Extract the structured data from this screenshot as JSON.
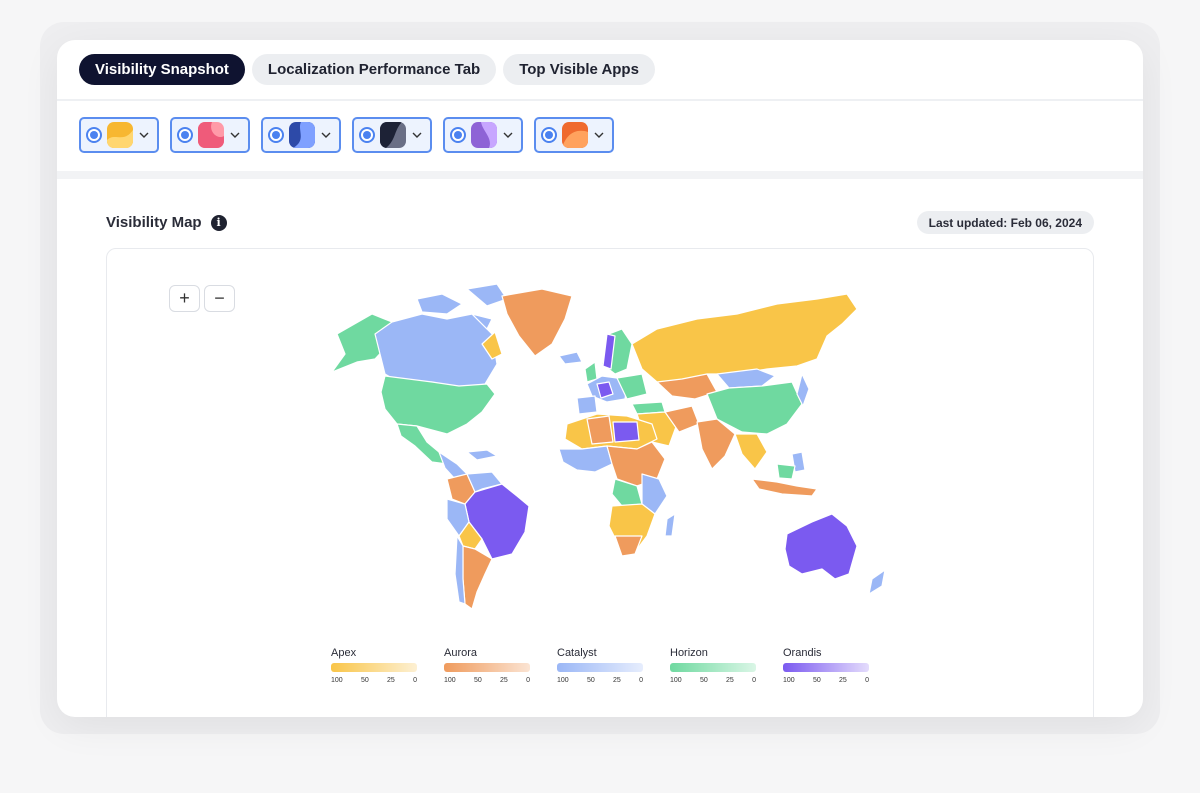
{
  "tabs": [
    {
      "label": "Visibility Snapshot",
      "active": true
    },
    {
      "label": "Localization Performance Tab",
      "active": false
    },
    {
      "label": "Top Visible Apps",
      "active": false
    }
  ],
  "apps": [
    {
      "name": "app-1",
      "colors": [
        "#f7b731",
        "#ffd670"
      ]
    },
    {
      "name": "app-2",
      "colors": [
        "#ef5b7a",
        "#ff9aa8"
      ]
    },
    {
      "name": "app-3",
      "colors": [
        "#2d4aa8",
        "#7fa0ff"
      ]
    },
    {
      "name": "app-4",
      "colors": [
        "#1d2236",
        "#6a6f86"
      ]
    },
    {
      "name": "app-5",
      "colors": [
        "#8e63d6",
        "#c7a6ff"
      ]
    },
    {
      "name": "app-6",
      "colors": [
        "#ef6a2e",
        "#ffa25e"
      ]
    }
  ],
  "section": {
    "title": "Visibility Map",
    "info_icon": "info-icon"
  },
  "last_updated": "Last updated: Feb 06, 2024",
  "zoom": {
    "in": "+",
    "out": "−"
  },
  "legend": [
    {
      "name": "Apex",
      "color": "#f9c548",
      "ticks": [
        "100",
        "50",
        "25",
        "0"
      ]
    },
    {
      "name": "Aurora",
      "color": "#ef9b5d",
      "ticks": [
        "100",
        "50",
        "25",
        "0"
      ]
    },
    {
      "name": "Catalyst",
      "color": "#9bb7f6",
      "ticks": [
        "100",
        "50",
        "25",
        "0"
      ]
    },
    {
      "name": "Horizon",
      "color": "#6fd9a0",
      "ticks": [
        "100",
        "50",
        "25",
        "0"
      ]
    },
    {
      "name": "Orandis",
      "color": "#7b5af0",
      "ticks": [
        "100",
        "50",
        "25",
        "0"
      ]
    }
  ]
}
